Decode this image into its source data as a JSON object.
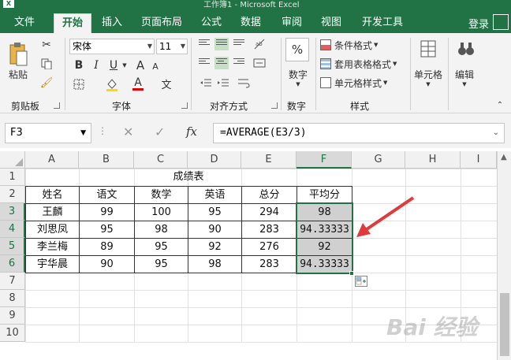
{
  "window": {
    "title": "工作簿1 - Microsoft Excel",
    "app_logo": "X"
  },
  "tabs": [
    "文件",
    "开始",
    "插入",
    "页面布局",
    "公式",
    "数据",
    "审阅",
    "视图",
    "开发工具"
  ],
  "active_tab": "开始",
  "account": {
    "login_label": "登录"
  },
  "ribbon": {
    "clipboard": {
      "group_label": "剪贴板",
      "paste_label": "粘贴"
    },
    "font": {
      "group_label": "字体",
      "font_name": "宋体",
      "font_size": "11",
      "bold": "B",
      "italic": "I",
      "underline": "U",
      "grow": "A",
      "shrink": "A",
      "font_color": "A",
      "phonetic": "文"
    },
    "alignment": {
      "group_label": "对齐方式"
    },
    "number": {
      "group_label": "数字",
      "button_label": "数字",
      "percent": "%"
    },
    "styles": {
      "group_label": "样式",
      "conditional": "条件格式",
      "table": "套用表格格式",
      "cell_styles": "单元格样式"
    },
    "cells": {
      "button_label": "单元格"
    },
    "editing": {
      "button_label": "编辑"
    }
  },
  "formula_bar": {
    "name_box": "F3",
    "fx": "fx",
    "cancel": "✕",
    "enter": "✓",
    "formula": "=AVERAGE(E3/3)"
  },
  "columns": [
    "A",
    "B",
    "C",
    "D",
    "E",
    "F",
    "G",
    "H",
    "I"
  ],
  "rows": [
    "1",
    "2",
    "3",
    "4",
    "5",
    "6",
    "7",
    "8",
    "9",
    "10"
  ],
  "sheet": {
    "title": "成绩表",
    "headers": [
      "姓名",
      "语文",
      "数学",
      "英语",
      "总分",
      "平均分"
    ],
    "records": [
      [
        "王麟",
        "99",
        "100",
        "95",
        "294",
        "98"
      ],
      [
        "刘思凤",
        "95",
        "98",
        "90",
        "283",
        "94.33333"
      ],
      [
        "李兰梅",
        "89",
        "95",
        "92",
        "276",
        "92"
      ],
      [
        "宇华晨",
        "90",
        "95",
        "98",
        "283",
        "94.33333"
      ]
    ]
  },
  "watermark": "Bai 经验",
  "colors": {
    "excel_green": "#217346",
    "annotation_arrow": "#e03a3a",
    "avg_fill": "#d0d0d0"
  }
}
